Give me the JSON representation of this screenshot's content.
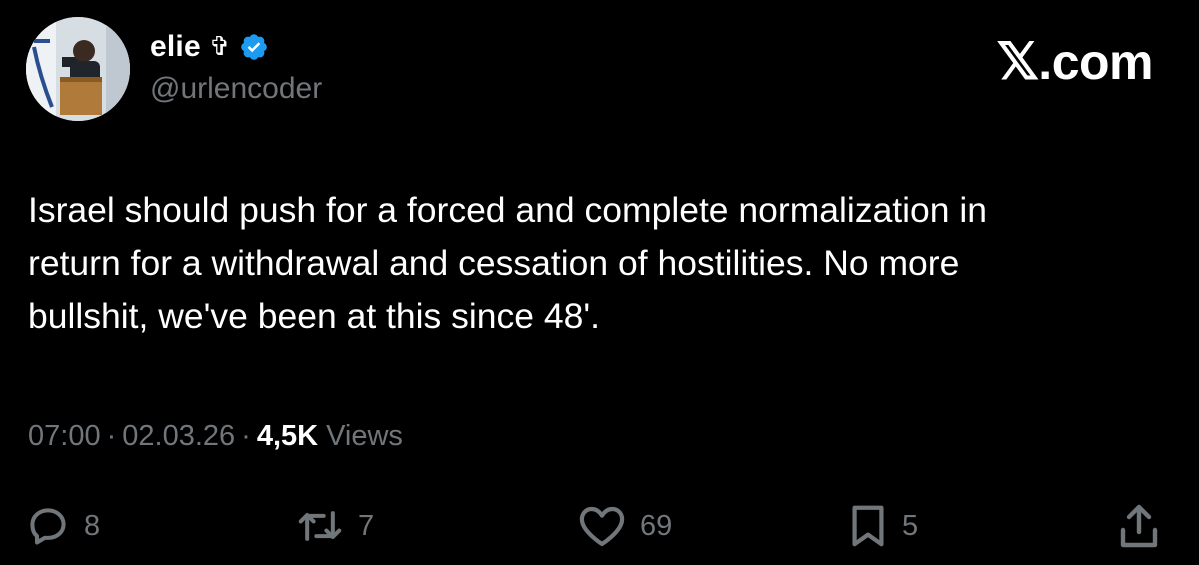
{
  "author": {
    "display_name": "elie",
    "cross_symbol": "✞",
    "verified_icon": "verified-badge-icon",
    "handle": "@urlencoder"
  },
  "brand": {
    "x_glyph": "𝕏",
    "suffix": ".com"
  },
  "tweet": {
    "text": "Israel should push for a forced and complete normalization in\nreturn for a withdrawal and cessation of hostilities. No more\nbullshit, we've been at this since 48'."
  },
  "meta": {
    "time": "07:00",
    "separator": "·",
    "date": "02.03.26",
    "views_count": "4,5K",
    "views_label": "Views"
  },
  "actions": {
    "replies": {
      "icon": "reply-icon",
      "count": "8"
    },
    "reposts": {
      "icon": "repost-icon",
      "count": "7"
    },
    "likes": {
      "icon": "heart-icon",
      "count": "69"
    },
    "bookmarks": {
      "icon": "bookmark-icon",
      "count": "5"
    },
    "share": {
      "icon": "share-icon"
    }
  },
  "colors": {
    "background": "#000000",
    "primary_text": "#ffffff",
    "secondary_text": "#71767b",
    "verified_blue": "#1d9bf0"
  }
}
